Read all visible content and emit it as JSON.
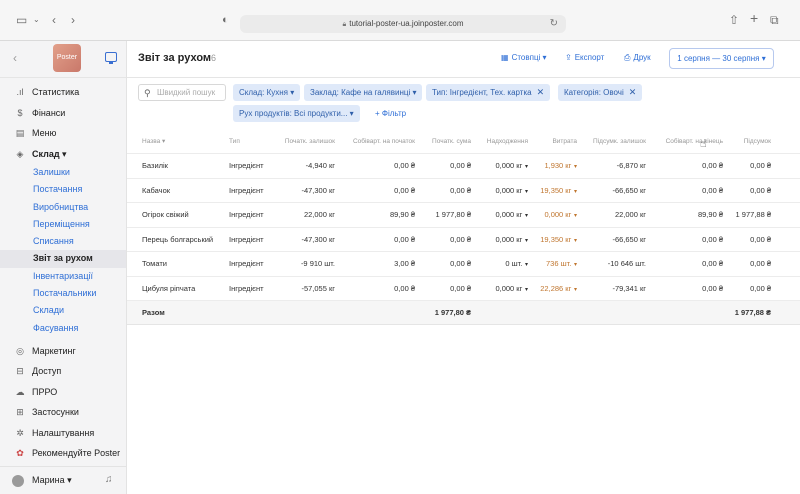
{
  "browser": {
    "url": "tutorial-poster-ua.joinposter.com"
  },
  "sidebar": {
    "logo": "Poster",
    "items": [
      {
        "label": "Статистика",
        "icon": "bar-chart-icon",
        "glyph": ".ıl"
      },
      {
        "label": "Фінанси",
        "icon": "dollar-icon",
        "glyph": "$"
      },
      {
        "label": "Меню",
        "icon": "document-icon",
        "glyph": "▤"
      },
      {
        "label": "Склад ▾",
        "icon": "layers-icon",
        "glyph": "◈"
      }
    ],
    "subitems": [
      {
        "label": "Залишки"
      },
      {
        "label": "Постачання"
      },
      {
        "label": "Виробництва"
      },
      {
        "label": "Переміщення"
      },
      {
        "label": "Списання"
      },
      {
        "label": "Звіт за рухом",
        "active": true
      },
      {
        "label": "Інвентаризації"
      },
      {
        "label": "Постачальники"
      },
      {
        "label": "Склади"
      },
      {
        "label": "Фасування"
      }
    ],
    "items2": [
      {
        "label": "Маркетинг",
        "icon": "target-icon",
        "glyph": "◎"
      },
      {
        "label": "Доступ",
        "icon": "lock-icon",
        "glyph": "⊟"
      },
      {
        "label": "ПРРО",
        "icon": "cloud-icon",
        "glyph": "☁"
      },
      {
        "label": "Застосунки",
        "icon": "grid-icon",
        "glyph": "⊞"
      },
      {
        "label": "Налаштування",
        "icon": "gear-icon",
        "glyph": "✲"
      },
      {
        "label": "Рекомендуйте Poster",
        "icon": "gift-icon",
        "glyph": "✿"
      }
    ],
    "user": "Марина ▾"
  },
  "header": {
    "title": "Звіт за рухом",
    "count": "6",
    "columns_btn": "Стовпці ▾",
    "export_btn": "Експорт",
    "print_btn": "Друк",
    "date_range": "1 серпня — 30 серпня ▾"
  },
  "filters": {
    "search_placeholder": "Швидкий пошук",
    "chips": [
      {
        "label": "Склад: Кухня ▾",
        "close": ""
      },
      {
        "label": "Заклад: Кафе на галявинці ▾",
        "close": ""
      },
      {
        "label": "Тип: Інгредієнт, Тех. картка",
        "close": "✕"
      },
      {
        "label": "Категорія: Овочі",
        "close": "✕"
      },
      {
        "label": "Рух продуктів: Всі продукти... ▾",
        "close": ""
      }
    ],
    "add_filter": "+ Фільтр"
  },
  "table": {
    "columns": {
      "name": "Назва ▾",
      "type": "Тип",
      "opening": "Початк. залишок",
      "cost_start": "Собіварт. на початок",
      "sum_start": "Початк. сума",
      "incoming": "Надходження",
      "outgoing": "Витрата",
      "closing": "Підсумк. залишок",
      "cost_end": "Собіварт. на кінець",
      "total": "Підсумок"
    },
    "rows": [
      {
        "name": "Базилік",
        "type": "Інгредієнт",
        "opening": "-4,940 кг",
        "cost_start": "0,00 ₴",
        "sum_start": "0,00 ₴",
        "incoming": "0,000 кг",
        "outgoing": "1,930 кг",
        "closing": "-6,870 кг",
        "cost_end": "0,00 ₴",
        "total": "0,00 ₴"
      },
      {
        "name": "Кабачок",
        "type": "Інгредієнт",
        "opening": "-47,300 кг",
        "cost_start": "0,00 ₴",
        "sum_start": "0,00 ₴",
        "incoming": "0,000 кг",
        "outgoing": "19,350 кг",
        "closing": "-66,650 кг",
        "cost_end": "0,00 ₴",
        "total": "0,00 ₴"
      },
      {
        "name": "Огірок свіжий",
        "type": "Інгредієнт",
        "opening": "22,000 кг",
        "cost_start": "89,90 ₴",
        "sum_start": "1 977,80 ₴",
        "incoming": "0,000 кг",
        "outgoing": "0,000 кг",
        "closing": "22,000 кг",
        "cost_end": "89,90 ₴",
        "total": "1 977,88 ₴"
      },
      {
        "name": "Перець болгарський",
        "type": "Інгредієнт",
        "opening": "-47,300 кг",
        "cost_start": "0,00 ₴",
        "sum_start": "0,00 ₴",
        "incoming": "0,000 кг",
        "outgoing": "19,350 кг",
        "closing": "-66,650 кг",
        "cost_end": "0,00 ₴",
        "total": "0,00 ₴"
      },
      {
        "name": "Томати",
        "type": "Інгредієнт",
        "opening": "-9 910 шт.",
        "cost_start": "3,00 ₴",
        "sum_start": "0,00 ₴",
        "incoming": "0 шт.",
        "outgoing": "736 шт.",
        "closing": "-10 646 шт.",
        "cost_end": "0,00 ₴",
        "total": "0,00 ₴"
      },
      {
        "name": "Цибуля ріпчата",
        "type": "Інгредієнт",
        "opening": "-57,055 кг",
        "cost_start": "0,00 ₴",
        "sum_start": "0,00 ₴",
        "incoming": "0,000 кг",
        "outgoing": "22,286 кг",
        "closing": "-79,341 кг",
        "cost_end": "0,00 ₴",
        "total": "0,00 ₴"
      }
    ],
    "totals": {
      "name": "Разом",
      "sum_start": "1 977,80 ₴",
      "total": "1 977,88 ₴"
    }
  },
  "colors": {
    "accent": "#2f6fd6",
    "chip_bg": "#dfe9f9",
    "outgoing": "#c0762f"
  }
}
